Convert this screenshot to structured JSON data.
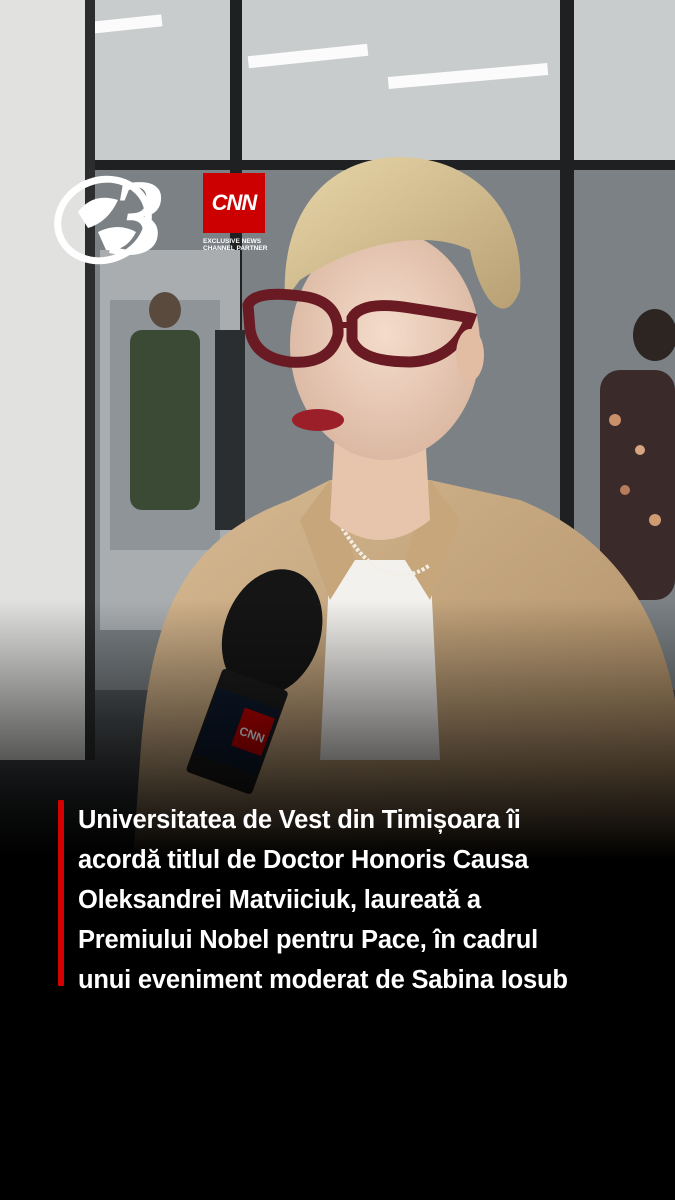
{
  "brand": {
    "channel_logo": "antena-3-logo",
    "partner_logo_text": "CNN",
    "partner_tagline": "EXCLUSIVE NEWS CHANNEL PARTNER",
    "mic_flag_text": "CNN"
  },
  "caption": {
    "lines": [
      "Universitatea de Vest din Timișoara îi",
      "acordă titlul de Doctor Honoris Causa",
      "Oleksandrei Matviiciuk, laureată a",
      "Premiului Nobel pentru Pace, în cadrul",
      "unui eveniment moderat de Sabina Iosub"
    ],
    "accent_color": "#d50000"
  }
}
